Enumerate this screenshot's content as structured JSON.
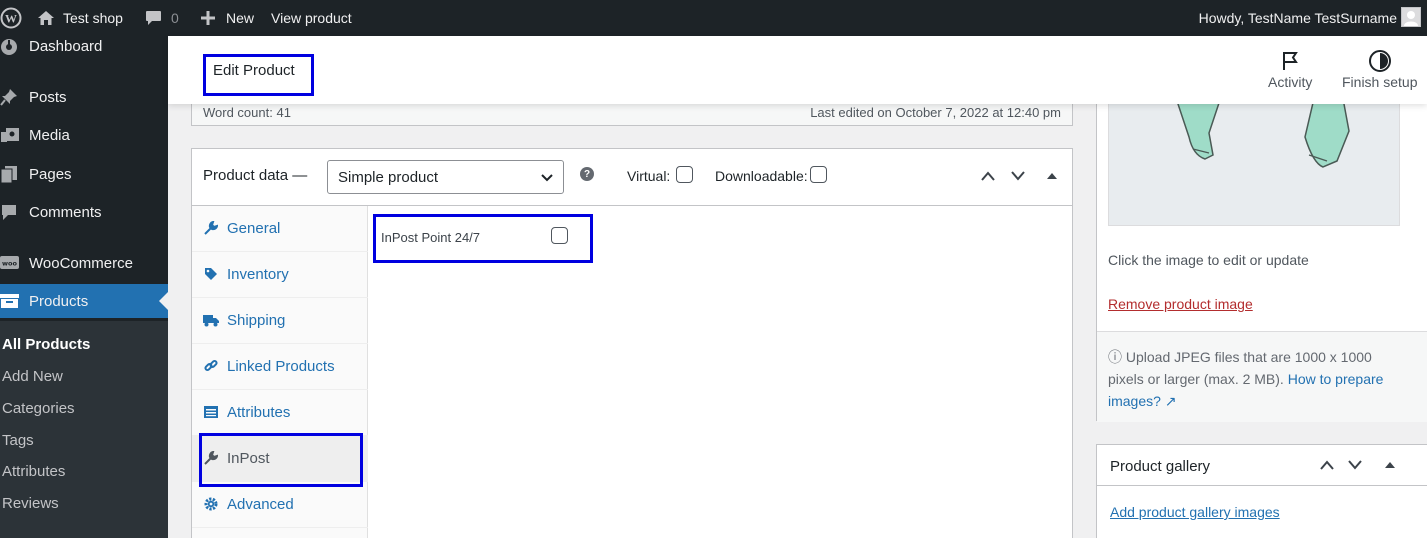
{
  "adminbar": {
    "site_name": "Test shop",
    "comments_count": "0",
    "new_label": "New",
    "view_product_label": "View product",
    "howdy": "Howdy, TestName TestSurname"
  },
  "sidebar": {
    "items": [
      {
        "label": "Dashboard",
        "icon": "dashboard-icon"
      },
      {
        "label": "Posts",
        "icon": "pin-icon"
      },
      {
        "label": "Media",
        "icon": "media-icon"
      },
      {
        "label": "Pages",
        "icon": "pages-icon"
      },
      {
        "label": "Comments",
        "icon": "comment-icon"
      },
      {
        "label": "WooCommerce",
        "icon": "woo-icon"
      },
      {
        "label": "Products",
        "icon": "archive-icon"
      }
    ],
    "submenu": [
      "All Products",
      "Add New",
      "Categories",
      "Tags",
      "Attributes",
      "Reviews"
    ]
  },
  "header": {
    "title": "Edit Product",
    "activity_label": "Activity",
    "finish_setup_label": "Finish setup"
  },
  "editor": {
    "word_count": "Word count: 41",
    "last_edited": "Last edited on October 7, 2022 at 12:40 pm"
  },
  "product_data": {
    "title": "Product data —",
    "type_selected": "Simple product",
    "virtual_label": "Virtual:",
    "downloadable_label": "Downloadable:",
    "tabs": [
      "General",
      "Inventory",
      "Shipping",
      "Linked Products",
      "Attributes",
      "InPost",
      "Advanced"
    ],
    "active_tab": "InPost",
    "inpost_field_label": "InPost Point 24/7"
  },
  "product_image": {
    "hint": "Click the image to edit or update",
    "remove_label": "Remove product image",
    "upload_note": "Upload JPEG files that are 1000 x 1000 pixels or larger (max. 2 MB).",
    "upload_link": "How to prepare images?"
  },
  "gallery": {
    "title": "Product gallery",
    "add_link": "Add product gallery images"
  },
  "colors": {
    "admin_dark": "#1d2327",
    "accent_blue": "#2271b1",
    "highlight_box": "#0000e0",
    "remove_red": "#b32d2e"
  }
}
